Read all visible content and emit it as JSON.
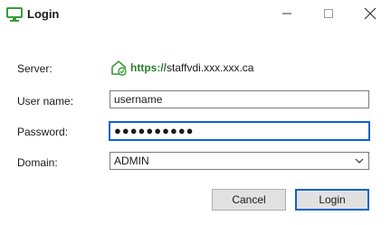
{
  "window": {
    "title": "Login",
    "controls": {
      "minimize": "minimize-icon",
      "maximize": "maximize-icon",
      "close": "close-icon"
    }
  },
  "form": {
    "server": {
      "label": "Server:",
      "scheme": "https://",
      "host": "staffvdi.xxx.xxx.ca",
      "icon": "secure-connection-icon"
    },
    "username": {
      "label": "User name:",
      "value": "username"
    },
    "password": {
      "label": "Password:",
      "masked_value": "●●●●●●●●●●"
    },
    "domain": {
      "label": "Domain:",
      "selected": "ADMIN"
    }
  },
  "buttons": {
    "cancel": "Cancel",
    "login": "Login"
  },
  "colors": {
    "accent": "#0a64c8",
    "secure": "#2e7d32",
    "button_bg": "#e1e1e1"
  }
}
